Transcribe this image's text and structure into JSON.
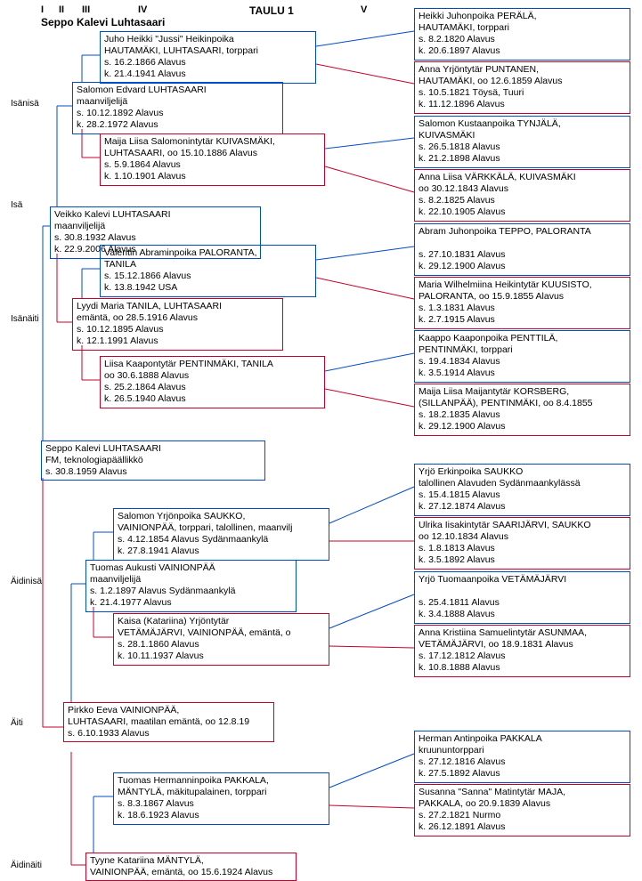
{
  "header": {
    "gens": [
      "I",
      "II",
      "III",
      "IV",
      "V"
    ],
    "title": "Seppo Kalevi Luhtasaari",
    "taulu": "TAULU 1"
  },
  "side": {
    "isanisa": "Isänisä",
    "isa": "Isä",
    "isanaiti": "Isänäiti",
    "aidinisa": "Äidinisä",
    "aiti": "Äiti",
    "aidinaiti": "Äidinäiti"
  },
  "p": {
    "root": "Seppo Kalevi  LUHTASAARI\nFM, teknologiapäällikkö\ns. 30.8.1959 Alavus",
    "isa": "Veikko Kalevi  LUHTASAARI\nmaanviljelijä\ns. 30.8.1932 Alavus\nk. 22.9.2006 Alavus",
    "aiti": "Pirkko Eeva  VAINIONPÄÄ,\nLUHTASAARI, maatilan emäntä, oo 12.8.19\ns. 6.10.1933 Alavus",
    "ii": "Salomon Edvard  LUHTASAARI\nmaanviljelijä\ns. 10.12.1892 Alavus\nk. 28.2.1972 Alavus",
    "ia": "Lyydi Maria  TANILA, LUHTASAARI\nemäntä, oo 28.5.1916 Alavus\ns. 10.12.1895 Alavus\nk. 12.1.1991 Alavus",
    "ai": "Tuomas Aukusti  VAINIONPÄÄ\nmaanviljelijä\ns. 1.2.1897 Alavus Sydänmaankylä\nk. 21.4.1977 Alavus",
    "aa": "Tyyne Katariina  MÄNTYLÄ,\nVAINIONPÄÄ, emäntä, oo 15.6.1924 Alavus",
    "iii": "Juho Heikki \"Jussi\" Heikinpoika\nHAUTAMÄKI, LUHTASAARI, torppari\ns. 16.2.1866 Alavus\nk. 21.4.1941 Alavus",
    "iia": "Maija Liisa Salomonintytär  KUIVASMÄKI,\nLUHTASAARI, oo 15.10.1886 Alavus\ns. 5.9.1864 Alavus\nk. 1.10.1901 Alavus",
    "iai": "Valentin Abraminpoika  PALORANTA,\nTANILA\ns. 15.12.1866 Alavus\nk. 13.8.1942 USA",
    "iaa": "Liisa Kaapontytär  PENTINMÄKI, TANILA\noo 30.6.1888 Alavus\ns. 25.2.1864 Alavus\nk. 26.5.1940 Alavus",
    "aii": "Salomon Yrjönpoika  SAUKKO,\nVAINIONPÄÄ, torppari, talollinen, maanvilj\ns. 4.12.1854 Alavus Sydänmaankylä\nk. 27.8.1941 Alavus",
    "aia": "Kaisa (Katariina) Yrjöntytär\nVETÄMÄJÄRVI, VAINIONPÄÄ, emäntä, o\ns. 28.1.1860 Alavus\nk. 10.11.1937 Alavus",
    "aai": "Tuomas Hermanninpoika  PAKKALA,\nMÄNTYLÄ, mäkitupalainen, torppari\ns. 8.3.1867 Alavus\nk. 18.6.1923 Alavus",
    "v1": "Heikki Juhonpoika  PERÄLÄ,\nHAUTAMÄKI, torppari\ns. 8.2.1820 Alavus\nk. 20.6.1897 Alavus",
    "v2": "Anna Yrjöntytär  PUNTANEN,\nHAUTAMÄKI, oo 12.6.1859 Alavus\ns. 10.5.1821 Töysä, Tuuri\nk. 11.12.1896 Alavus",
    "v3": "Salomon Kustaanpoika  TYNJÄLÄ,\nKUIVASMÄKI\ns. 26.5.1818 Alavus\nk. 21.2.1898 Alavus",
    "v4": "Anna Liisa  VÄRKKÄLÄ, KUIVASMÄKI\noo 30.12.1843 Alavus\ns. 8.2.1825 Alavus\nk. 22.10.1905 Alavus",
    "v5": "Abram Juhonpoika  TEPPO, PALORANTA\n\ns. 27.10.1831 Alavus\nk. 29.12.1900 Alavus",
    "v6": "Maria Wilhelmiina Heikintytär  KUUSISTO,\nPALORANTA, oo 15.9.1855 Alavus\ns. 1.3.1831 Alavus\nk. 2.7.1915 Alavus",
    "v7": "Kaappo Kaaponpoika  PENTTILÄ,\nPENTINMÄKI, torppari\ns. 19.4.1834 Alavus\nk. 3.5.1914 Alavus",
    "v8": "Maija Liisa Maijantytär  KORSBERG,\n(SILLANPÄÄ), PENTINMÄKI, oo 8.4.1855\ns. 18.2.1835 Alavus\nk. 29.12.1900 Alavus",
    "v9": "Yrjö Erkinpoika  SAUKKO\ntalollinen Alavuden Sydänmaankylässä\ns. 15.4.1815 Alavus\nk. 27.12.1874 Alavus",
    "v10": "Ulrika Iisakintytär  SAARIJÄRVI, SAUKKO\noo 12.10.1834 Alavus\ns. 1.8.1813 Alavus\nk. 3.5.1892 Alavus",
    "v11": "Yrjö Tuomaanpoika  VETÄMÄJÄRVI\n\ns. 25.4.1811 Alavus\nk. 3.4.1888 Alavus",
    "v12": "Anna Kristiina Samuelintytär  ASUNMAA,\nVETÄMÄJÄRVI, oo 18.9.1831 Alavus\ns. 17.12.1812 Alavus\nk. 10.8.1888 Alavus",
    "v13": "Herman Antinpoika  PAKKALA\nkruununtorppari\ns. 27.12.1816 Alavus\nk. 27.5.1892 Alavus",
    "v14": "Susanna \"Sanna\" Matintytär  MAJA,\nPAKKALA, oo 20.9.1839 Alavus\ns. 27.2.1821 Nurmo\nk. 26.12.1891 Alavus"
  }
}
